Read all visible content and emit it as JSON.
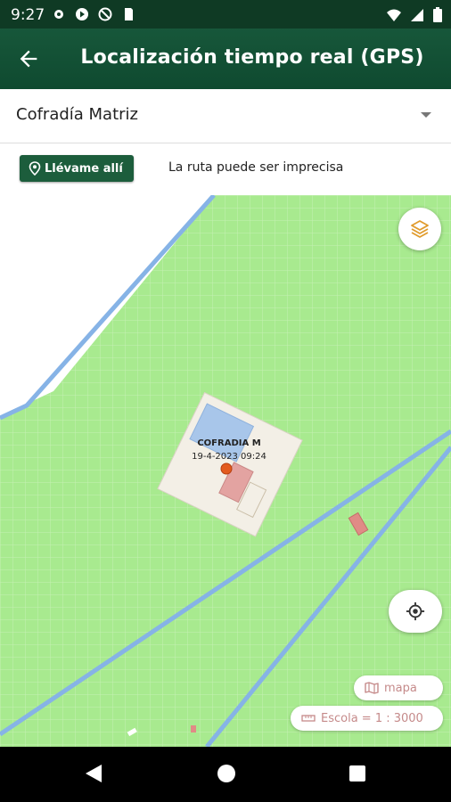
{
  "status_bar": {
    "time": "9:27"
  },
  "app_bar": {
    "title": "Localización tiempo real (GPS)"
  },
  "selector": {
    "value": "Cofradía Matriz"
  },
  "route": {
    "button_label": "Llévame allí",
    "note": "La ruta puede ser imprecisa"
  },
  "map": {
    "marker_name": "COFRADIA M",
    "marker_datetime": "19-4-2023 09:24",
    "map_type_label": "mapa",
    "scale_label": "Escola = 1 : 3000"
  },
  "colors": {
    "appbar": "#17573a",
    "map_green": "#a8ea8f",
    "road": "#86b3e6",
    "marker": "#e35b1f"
  }
}
